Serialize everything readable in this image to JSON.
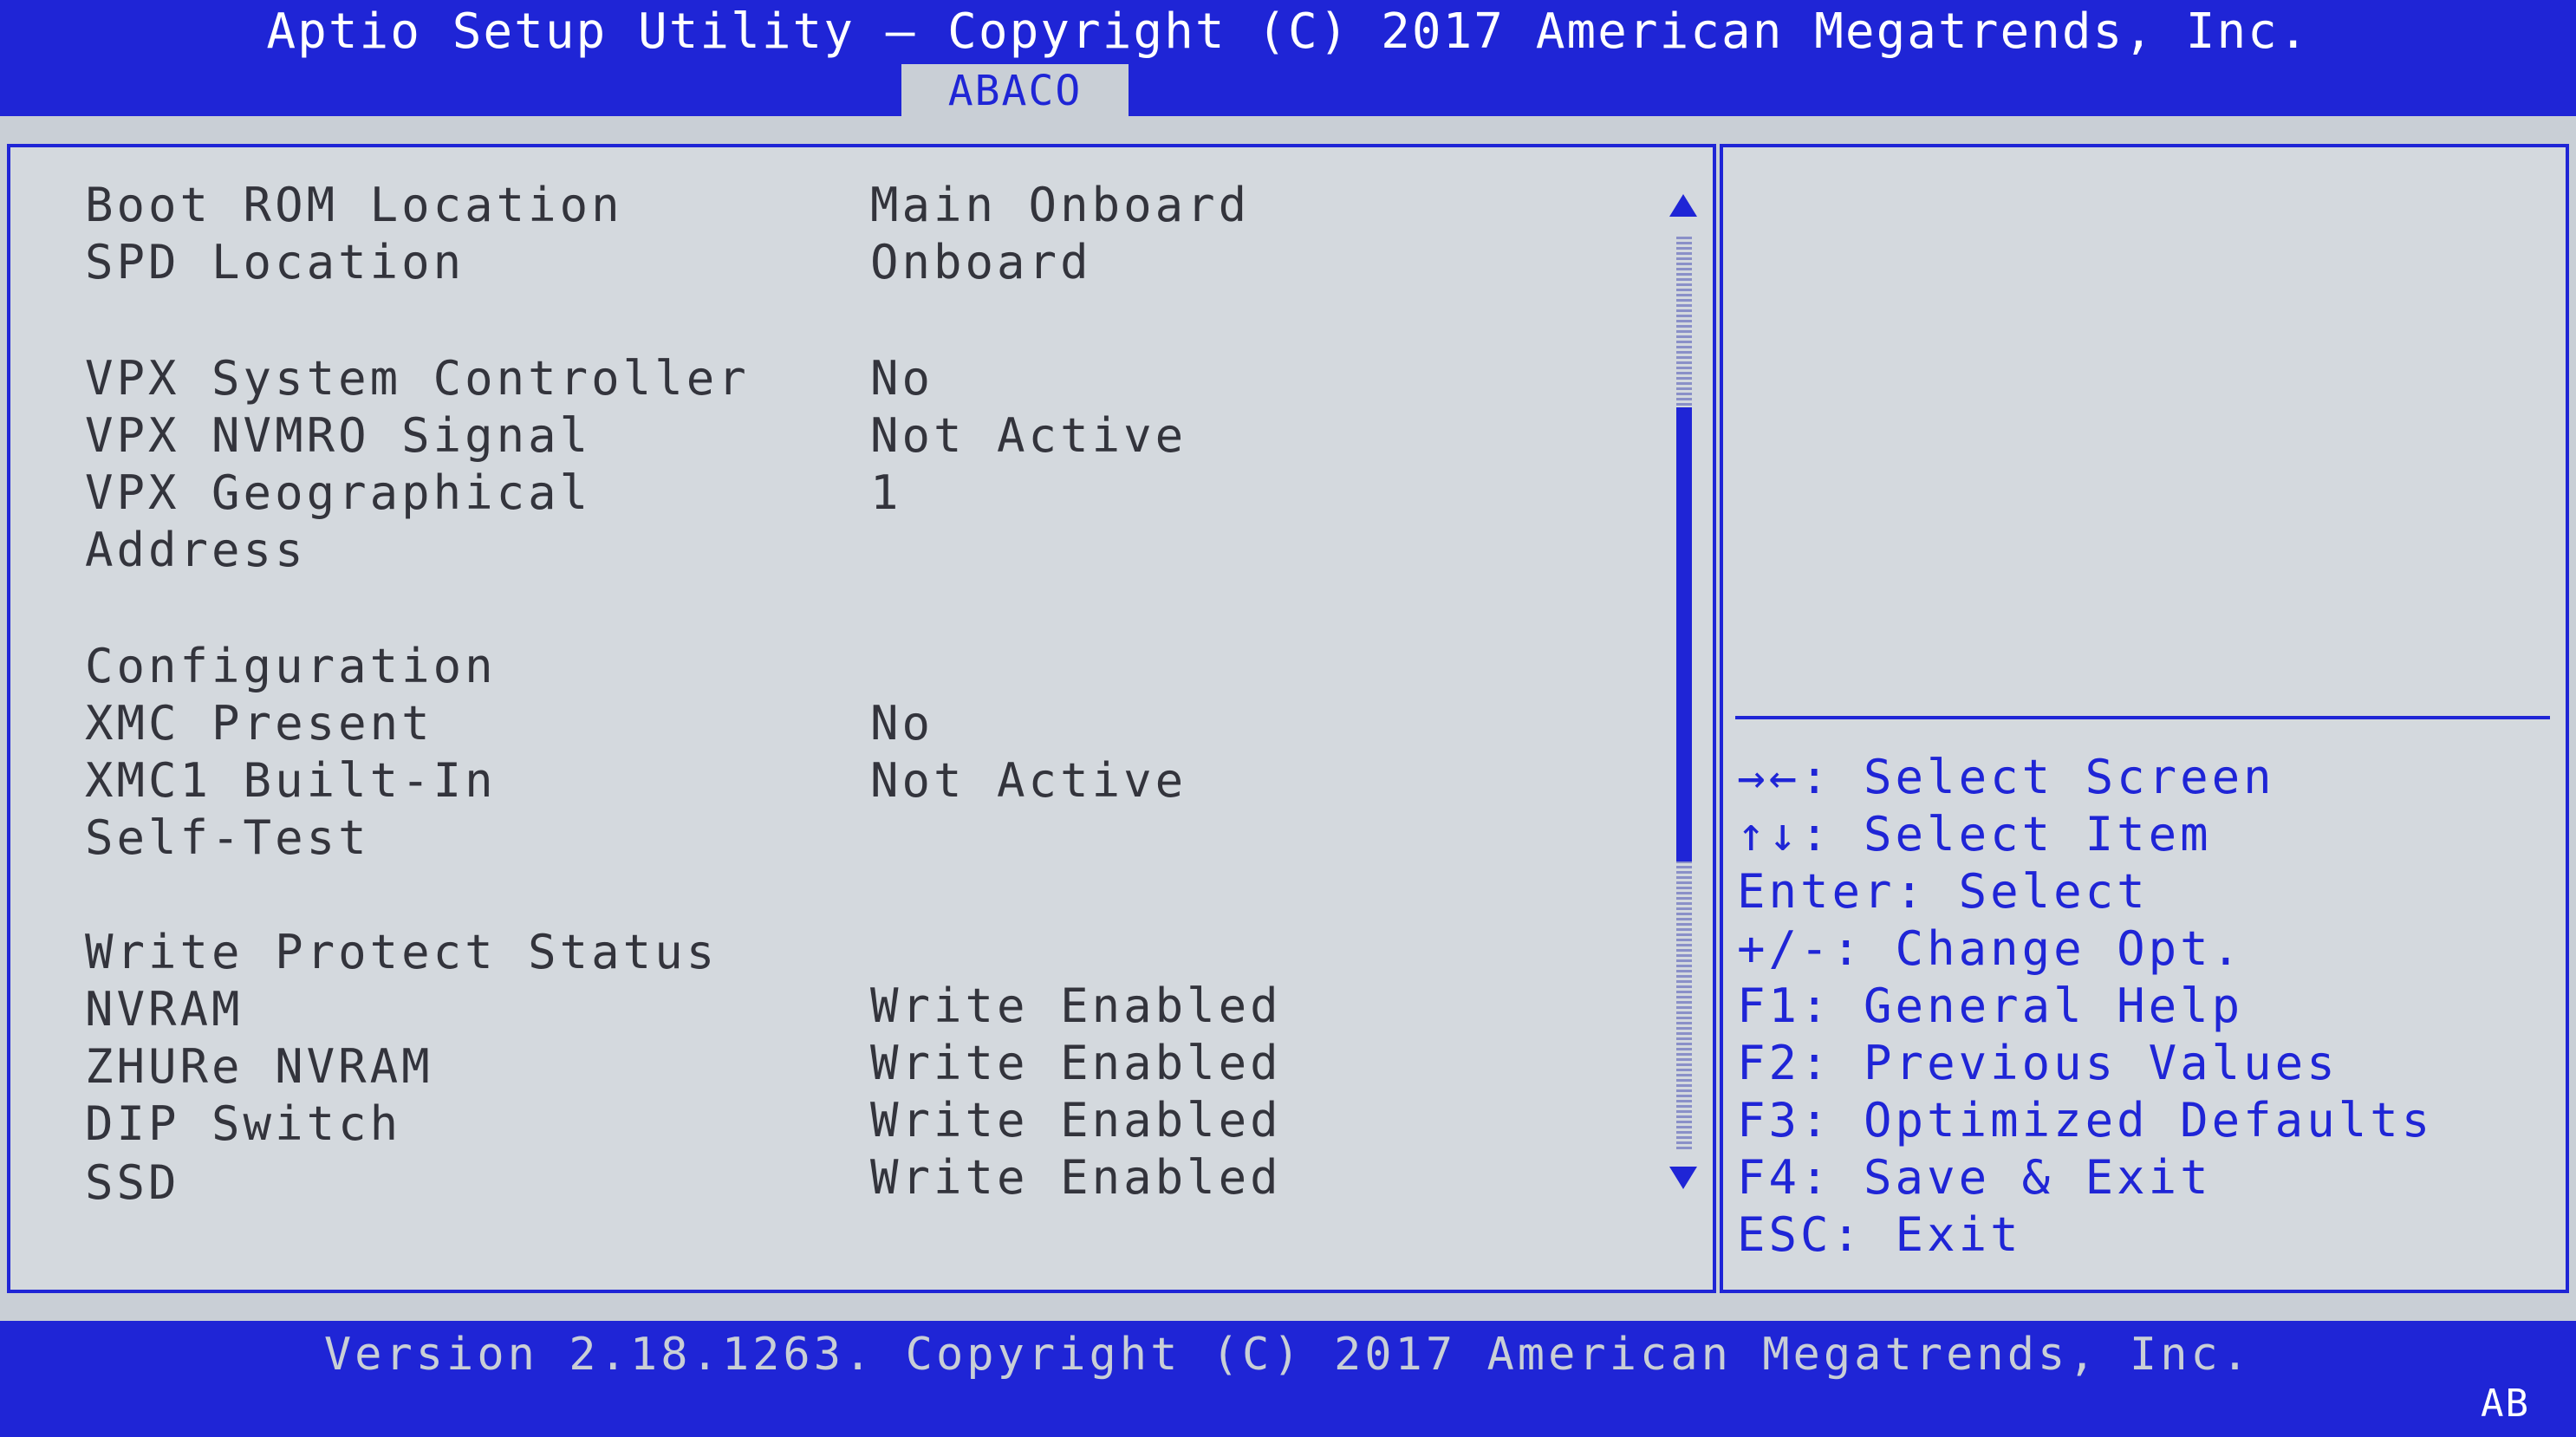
{
  "header": {
    "title": "Aptio Setup Utility – Copyright (C) 2017 American Megatrends, Inc.",
    "active_tab": "ABACO"
  },
  "settings": [
    {
      "label": "Boot ROM Location",
      "value": "Main Onboard"
    },
    {
      "label": "SPD Location",
      "value": "Onboard"
    },
    {
      "label": "VPX System Controller",
      "value": "No"
    },
    {
      "label": "VPX NVMRO Signal",
      "value": "Not Active"
    },
    {
      "label": "VPX Geographical",
      "value": "1"
    },
    {
      "label": "Address",
      "value": ""
    },
    {
      "label": "Configuration",
      "value": ""
    },
    {
      "label": "XMC Present",
      "value": "No"
    },
    {
      "label": "XMC1 Built-In",
      "value": "Not Active"
    },
    {
      "label": "Self-Test",
      "value": ""
    },
    {
      "label": "Write Protect Status",
      "value": ""
    },
    {
      "label": "NVRAM",
      "value": "Write Enabled"
    },
    {
      "label": "ZHURe NVRAM",
      "value": "Write Enabled"
    },
    {
      "label": "DIP Switch",
      "value": "Write Enabled"
    },
    {
      "label": "SSD",
      "value": "Write Enabled"
    }
  ],
  "help": [
    "→←: Select Screen",
    "↑↓: Select Item",
    "Enter: Select",
    "+/-: Change Opt.",
    "F1: General Help",
    "F2: Previous Values",
    "F3: Optimized Defaults",
    "F4: Save & Exit",
    "ESC: Exit"
  ],
  "footer": {
    "version": "Version 2.18.1263. Copyright (C) 2017 American Megatrends, Inc.",
    "corner": "AB"
  },
  "colors": {
    "accent": "#1f25d6",
    "background": "#c9cfd6",
    "text": "#33343c"
  },
  "icons": {
    "scroll_up": "scroll-up-arrow-icon",
    "scroll_down": "scroll-down-arrow-icon"
  }
}
